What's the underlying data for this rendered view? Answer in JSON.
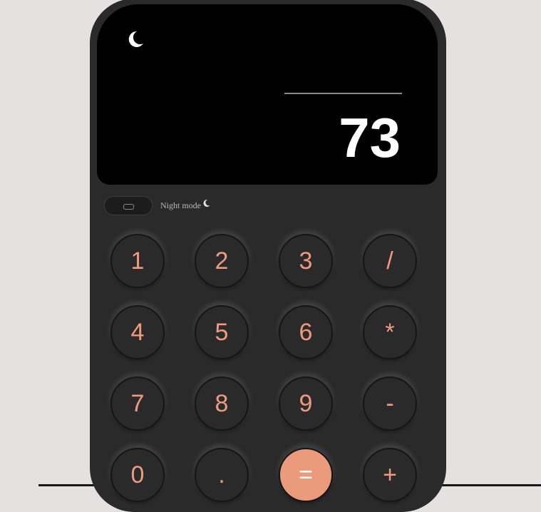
{
  "display": {
    "result": "73"
  },
  "mode_toggle": {
    "label": "Night mode",
    "state": "on"
  },
  "keys": [
    {
      "label": "1",
      "name": "key-1"
    },
    {
      "label": "2",
      "name": "key-2"
    },
    {
      "label": "3",
      "name": "key-3"
    },
    {
      "label": "/",
      "name": "key-divide"
    },
    {
      "label": "4",
      "name": "key-4"
    },
    {
      "label": "5",
      "name": "key-5"
    },
    {
      "label": "6",
      "name": "key-6"
    },
    {
      "label": "*",
      "name": "key-multiply"
    },
    {
      "label": "7",
      "name": "key-7"
    },
    {
      "label": "8",
      "name": "key-8"
    },
    {
      "label": "9",
      "name": "key-9"
    },
    {
      "label": "-",
      "name": "key-subtract"
    },
    {
      "label": "0",
      "name": "key-0"
    },
    {
      "label": ".",
      "name": "key-decimal"
    },
    {
      "label": "=",
      "name": "key-equals"
    },
    {
      "label": "+",
      "name": "key-add"
    }
  ],
  "colors": {
    "background": "#e6e1e1",
    "body": "#2a2a2a",
    "screen": "#000000",
    "accent": "#ec9a7c"
  },
  "icons": {
    "theme": "moon-icon"
  }
}
